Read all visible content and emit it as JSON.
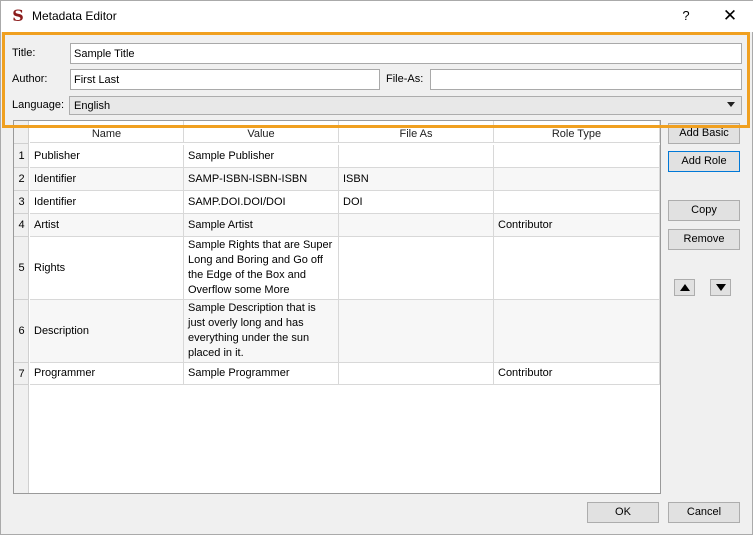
{
  "window": {
    "title": "Metadata Editor",
    "help_label": "?",
    "close_label": "✕"
  },
  "form": {
    "title_label": "Title:",
    "title_value": "Sample Title",
    "author_label": "Author:",
    "author_value": "First Last",
    "fileas_label": "File-As:",
    "fileas_value": "",
    "language_label": "Language:",
    "language_value": "English"
  },
  "table": {
    "headers": [
      "Name",
      "Value",
      "File As",
      "Role Type"
    ],
    "rows": [
      {
        "num": "1",
        "name": "Publisher",
        "value": "Sample Publisher",
        "file_as": "",
        "role": ""
      },
      {
        "num": "2",
        "name": "Identifier",
        "value": "SAMP-ISBN-ISBN-ISBN",
        "file_as": "ISBN",
        "role": ""
      },
      {
        "num": "3",
        "name": "Identifier",
        "value": "SAMP.DOI.DOI/DOI",
        "file_as": "DOI",
        "role": ""
      },
      {
        "num": "4",
        "name": "Artist",
        "value": "Sample Artist",
        "file_as": "",
        "role": "Contributor"
      },
      {
        "num": "5",
        "name": "Rights",
        "value": "Sample Rights that are Super Long and Boring and Go off the Edge of the Box and Overflow some More",
        "file_as": "",
        "role": ""
      },
      {
        "num": "6",
        "name": "Description",
        "value": "Sample Description that is just overly long and has everything under the sun placed in it.",
        "file_as": "",
        "role": ""
      },
      {
        "num": "7",
        "name": "Programmer",
        "value": "Sample Programmer",
        "file_as": "",
        "role": "Contributor"
      }
    ]
  },
  "side_buttons": {
    "add_basic": "Add Basic",
    "add_role": "Add Role",
    "copy": "Copy",
    "remove": "Remove"
  },
  "bottom_buttons": {
    "ok": "OK",
    "cancel": "Cancel"
  },
  "icons": {
    "app": "sigil-icon",
    "move_up": "arrow-up-icon",
    "move_down": "arrow-down-icon"
  },
  "colors": {
    "highlight": "#f0a020",
    "focus": "#0078d7"
  }
}
